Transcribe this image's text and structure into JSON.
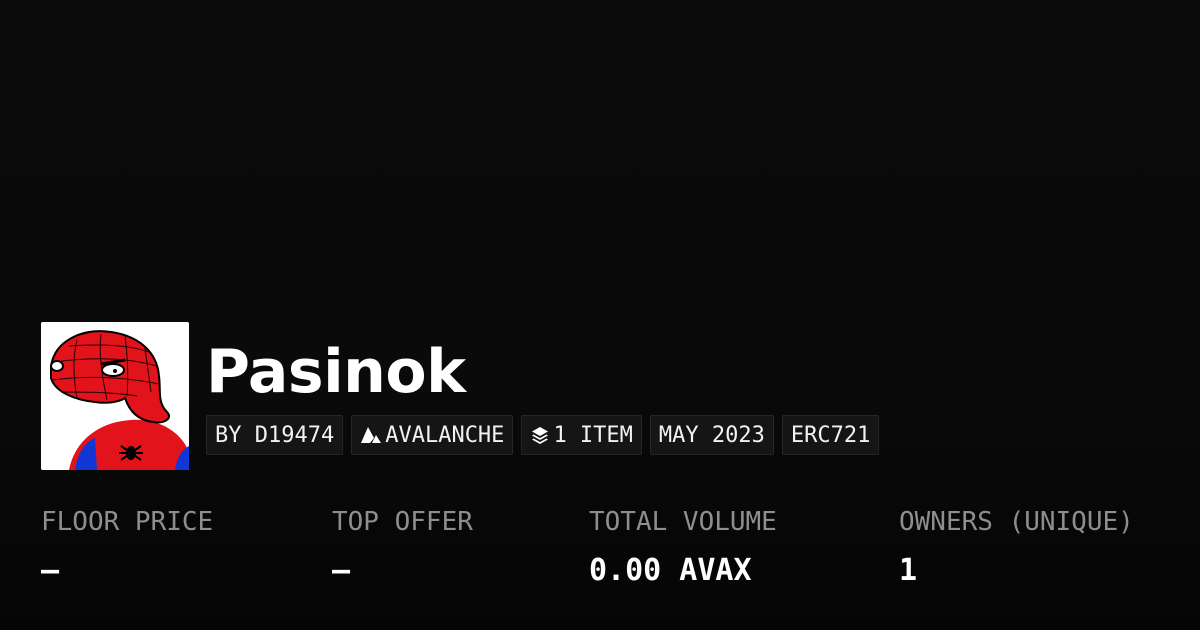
{
  "collection": {
    "name": "Pasinok",
    "avatar_icon": "spider-man-meme-icon"
  },
  "tags": {
    "creator": "BY D19474",
    "chain": "AVALANCHE",
    "chain_icon": "avalanche-logo-icon",
    "items": "1 ITEM",
    "items_icon": "layers-icon",
    "date": "MAY 2023",
    "standard": "ERC721"
  },
  "stats": {
    "floor_price": {
      "label": "FLOOR PRICE",
      "value": "–"
    },
    "top_offer": {
      "label": "TOP OFFER",
      "value": "–"
    },
    "total_volume": {
      "label": "TOTAL VOLUME",
      "value": "0.00 AVAX"
    },
    "owners": {
      "label": "OWNERS (UNIQUE)",
      "value": "1"
    }
  },
  "colors": {
    "background": "#0a0a0a",
    "label": "#8e8e8e",
    "value": "#ffffff",
    "tag_background": "#151515"
  }
}
